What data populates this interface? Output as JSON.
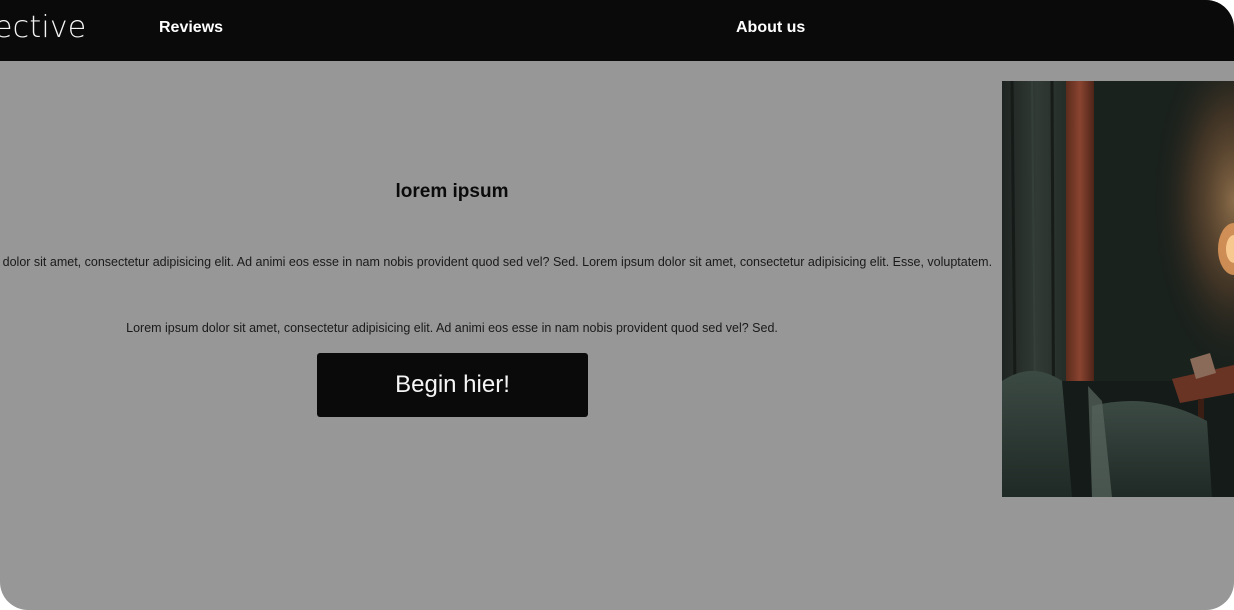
{
  "header": {
    "brand": "ective",
    "nav": {
      "reviews": "Reviews",
      "about": "About us"
    }
  },
  "hero": {
    "title": "lorem ipsum",
    "paragraph_1": "m ipsum dolor sit amet, consectetur adipisicing elit. Ad animi eos esse in nam nobis provident quod sed vel? Sed. Lorem ipsum dolor sit amet, consectetur adipisicing elit. Esse, voluptatem.",
    "paragraph_2": "Lorem ipsum dolor sit amet, consectetur adipisicing elit. Ad animi eos esse in nam nobis provident quod sed vel? Sed.",
    "cta_label": "Begin hier!"
  },
  "colors": {
    "header_bg": "#0a0a0a",
    "page_bg": "#979797",
    "button_bg": "#0a0a0a",
    "button_text": "#f5f5f5"
  }
}
